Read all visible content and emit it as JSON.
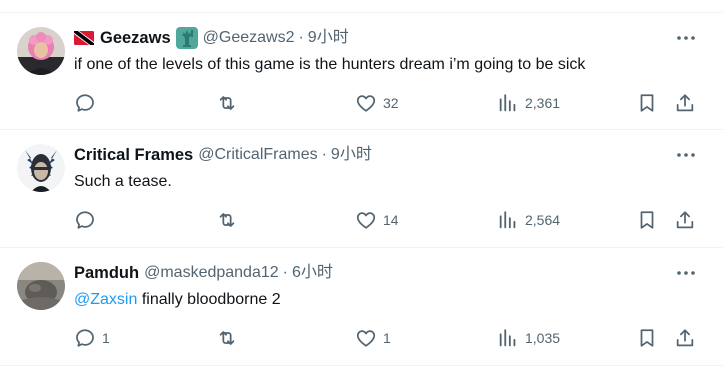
{
  "tweets": [
    {
      "display_name": "Geezaws",
      "handle": "@Geezaws2",
      "separator": "·",
      "time": "9小时",
      "text": "if one of the levels of this game is the hunters dream i’m going to be sick",
      "replies": "",
      "retweets": "",
      "likes": "32",
      "views": "2,361",
      "avatar_icon": "pink-hair-avatar",
      "badges": [
        "trinidad-flag-icon",
        "statue-of-liberty-icon"
      ]
    },
    {
      "display_name": "Critical Frames",
      "handle": "@CriticalFrames",
      "separator": "·",
      "time": "9小时",
      "text": "Such a tease.",
      "replies": "",
      "retweets": "",
      "likes": "14",
      "views": "2,564",
      "avatar_icon": "dark-portrait-avatar"
    },
    {
      "display_name": "Pamduh",
      "handle": "@maskedpanda12",
      "separator": "·",
      "time": "6小时",
      "mention": "@Zaxsin",
      "text": " finally bloodborne 2",
      "replies": "1",
      "retweets": "",
      "likes": "1",
      "views": "1,035",
      "avatar_icon": "gray-photo-avatar"
    }
  ],
  "colors": {
    "text": "#0f1419",
    "secondary": "#536471",
    "link": "#1d9bf0",
    "divider": "#eff3f4"
  }
}
